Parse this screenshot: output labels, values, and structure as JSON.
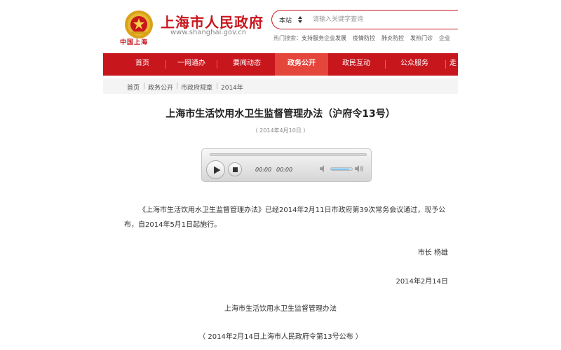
{
  "header": {
    "site_title": "上海市人民政府",
    "site_domain": "www.shanghai.gov.cn",
    "emblem_caption": "中国上海"
  },
  "search": {
    "scope": "本站",
    "placeholder": "请输入关键字查询",
    "hot_label": "热门搜索：",
    "hot_terms": [
      "支持服务企业发展",
      "疫情防控",
      "肺炎防控",
      "发热门诊",
      "企业"
    ]
  },
  "nav": {
    "items": [
      {
        "label": "首页",
        "active": false
      },
      {
        "label": "一网通办",
        "active": false
      },
      {
        "label": "要闻动态",
        "active": false
      },
      {
        "label": "政务公开",
        "active": true
      },
      {
        "label": "政民互动",
        "active": false
      },
      {
        "label": "公众服务",
        "active": false
      },
      {
        "label": "走",
        "active": false
      }
    ]
  },
  "breadcrumb": [
    "首页",
    "政务公开",
    "市政府规章",
    "2014年"
  ],
  "article": {
    "title": "上海市生活饮用水卫生监督管理办法（沪府令13号）",
    "date": "（ 2014年4月10日 ）",
    "paragraph1": "《上海市生活饮用水卫生监督管理办法》已经2014年2月11日市政府第39次常务会议通过，现予公布，自2014年5月1日起施行。",
    "mayor": "市长  杨雄",
    "sign_date": "2014年2月14日",
    "sub_title": "上海市生活饮用水卫生监督管理办法",
    "promulgation": "（ 2014年2月14日上海市人民政府令第13号公布 ）"
  },
  "player": {
    "current_time": "00:00",
    "duration": "00:00",
    "volume": 0.85
  },
  "colors": {
    "brand_red": "#c8161d",
    "nav_active": "#e5463b"
  },
  "icons": {
    "emblem": "national-emblem-icon",
    "play": "play-icon",
    "stop": "stop-icon",
    "volume_low": "volume-low-icon",
    "volume_high": "volume-high-icon",
    "scope_toggle": "chevron-updown-icon"
  }
}
